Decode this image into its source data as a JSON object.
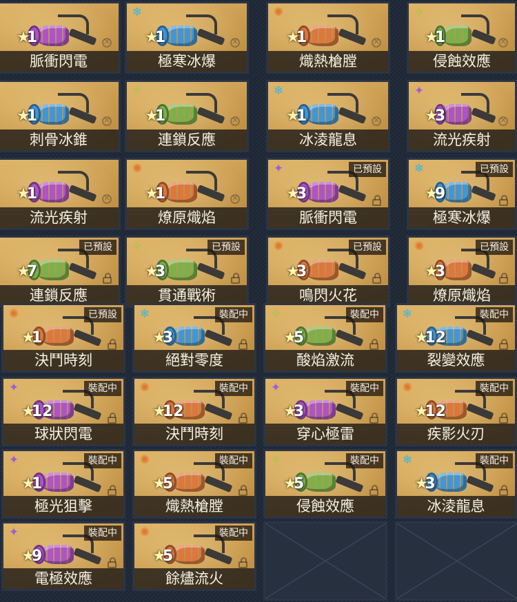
{
  "labels": {
    "preset": "已預設",
    "equipped": "裝配中"
  },
  "colors": {
    "purple": "#b052c9",
    "blue": "#3f97d8",
    "orange": "#e0763a",
    "green": "#79b348"
  },
  "element_icons": {
    "purple": {
      "glyph": "✦",
      "color": "#9a5fd6",
      "name": "void-element-icon"
    },
    "blue": {
      "glyph": "❄",
      "color": "#37b9e0",
      "name": "ice-element-icon"
    },
    "orange": {
      "glyph": "✺",
      "color": "#e07a2a",
      "name": "fire-element-icon"
    },
    "green": {
      "glyph": "✧",
      "color": "#8bd33c",
      "name": "corrosion-element-icon"
    }
  },
  "weapons": [
    {
      "name": "脈衝閃電",
      "level": "1",
      "color": "purple",
      "status": "",
      "show_icon": false
    },
    {
      "name": "極寒冰爆",
      "level": "1",
      "color": "blue",
      "status": "",
      "show_icon": true
    },
    {
      "name": "熾熱槍膛",
      "level": "1",
      "color": "orange",
      "status": "",
      "show_icon": true
    },
    {
      "name": "侵蝕效應",
      "level": "1",
      "color": "green",
      "status": "",
      "show_icon": true
    },
    {
      "name": "刺骨冰錐",
      "level": "1",
      "color": "blue",
      "status": "",
      "show_icon": false
    },
    {
      "name": "連鎖反應",
      "level": "1",
      "color": "green",
      "status": "",
      "show_icon": true
    },
    {
      "name": "冰淩龍息",
      "level": "1",
      "color": "blue",
      "status": "",
      "show_icon": true
    },
    {
      "name": "流光疾射",
      "level": "3",
      "color": "purple",
      "status": "",
      "show_icon": true
    },
    {
      "name": "流光疾射",
      "level": "1",
      "color": "purple",
      "status": "",
      "show_icon": false
    },
    {
      "name": "燎原熾焰",
      "level": "1",
      "color": "orange",
      "status": "",
      "show_icon": true
    },
    {
      "name": "脈衝閃電",
      "level": "3",
      "color": "purple",
      "status": "preset",
      "show_icon": true
    },
    {
      "name": "極寒冰爆",
      "level": "9",
      "color": "blue",
      "status": "preset",
      "show_icon": true
    },
    {
      "name": "連鎖反應",
      "level": "7",
      "color": "green",
      "status": "preset",
      "show_icon": false
    },
    {
      "name": "貫通戰術",
      "level": "3",
      "color": "green",
      "status": "preset",
      "show_icon": true
    },
    {
      "name": "鳴閃火花",
      "level": "3",
      "color": "orange",
      "status": "preset",
      "show_icon": true
    },
    {
      "name": "燎原熾焰",
      "level": "3",
      "color": "orange",
      "status": "preset",
      "show_icon": true
    },
    {
      "name": "決鬥時刻",
      "level": "1",
      "color": "orange",
      "status": "preset",
      "show_icon": true
    },
    {
      "name": "絕對零度",
      "level": "3",
      "color": "blue",
      "status": "equipped",
      "show_icon": true
    },
    {
      "name": "酸焰激流",
      "level": "5",
      "color": "green",
      "status": "equipped",
      "show_icon": true
    },
    {
      "name": "裂變效應",
      "level": "12",
      "color": "blue",
      "status": "equipped",
      "show_icon": true
    },
    {
      "name": "球狀閃電",
      "level": "12",
      "color": "purple",
      "status": "equipped",
      "show_icon": true
    },
    {
      "name": "決鬥時刻",
      "level": "12",
      "color": "orange",
      "status": "equipped",
      "show_icon": true
    },
    {
      "name": "穿心極雷",
      "level": "3",
      "color": "purple",
      "status": "equipped",
      "show_icon": true
    },
    {
      "name": "疾影火刃",
      "level": "12",
      "color": "orange",
      "status": "equipped",
      "show_icon": true
    },
    {
      "name": "極光狙擊",
      "level": "1",
      "color": "purple",
      "status": "equipped",
      "show_icon": true
    },
    {
      "name": "熾熱槍膛",
      "level": "5",
      "color": "orange",
      "status": "equipped",
      "show_icon": true
    },
    {
      "name": "侵蝕效應",
      "level": "5",
      "color": "green",
      "status": "equipped",
      "show_icon": true
    },
    {
      "name": "冰淩龍息",
      "level": "3",
      "color": "blue",
      "status": "equipped",
      "show_icon": true
    },
    {
      "name": "電極效應",
      "level": "9",
      "color": "purple",
      "status": "equipped",
      "show_icon": true
    },
    {
      "name": "餘燼流火",
      "level": "5",
      "color": "orange",
      "status": "equipped",
      "show_icon": true
    }
  ],
  "empty_slots": 2
}
